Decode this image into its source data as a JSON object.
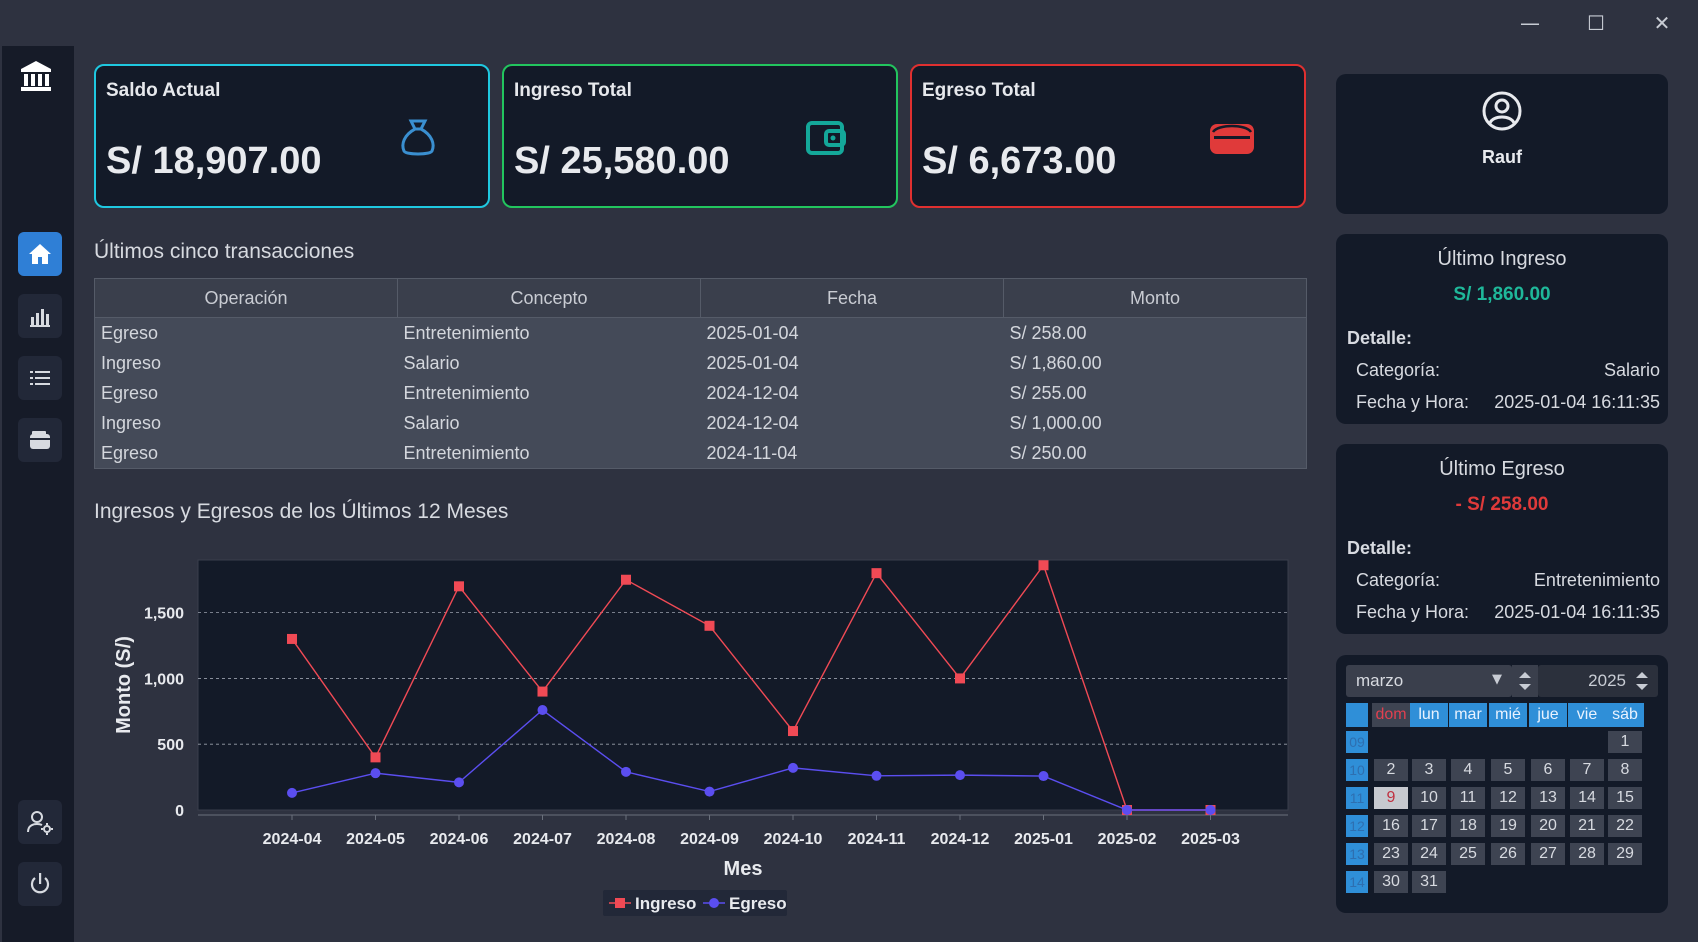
{
  "window": {
    "minimize": "—",
    "maximize": "☐",
    "close": "✕"
  },
  "cards": {
    "saldo": {
      "title": "Saldo Actual",
      "value": "S/ 18,907.00",
      "color": "#1fc8e0"
    },
    "ingreso": {
      "title": "Ingreso Total",
      "value": "S/ 25,580.00",
      "color": "#22c55e"
    },
    "egreso": {
      "title": "Egreso Total",
      "value": "S/ 6,673.00",
      "color": "#e03030"
    }
  },
  "transactions": {
    "title": "Últimos cinco transacciones",
    "columns": [
      "Operación",
      "Concepto",
      "Fecha",
      "Monto"
    ],
    "rows": [
      [
        "Egreso",
        "Entretenimiento",
        "2025-01-04",
        "S/ 258.00"
      ],
      [
        "Ingreso",
        "Salario",
        "2025-01-04",
        "S/ 1,860.00"
      ],
      [
        "Egreso",
        "Entretenimiento",
        "2024-12-04",
        "S/ 255.00"
      ],
      [
        "Ingreso",
        "Salario",
        "2024-12-04",
        "S/ 1,000.00"
      ],
      [
        "Egreso",
        "Entretenimiento",
        "2024-11-04",
        "S/ 250.00"
      ]
    ]
  },
  "chart_title": "Ingresos y Egresos de los Últimos 12 Meses",
  "chart_data": {
    "type": "line",
    "xlabel": "Mes",
    "ylabel": "Monto (S/)",
    "categories": [
      "2024-04",
      "2024-05",
      "2024-06",
      "2024-07",
      "2024-08",
      "2024-09",
      "2024-10",
      "2024-11",
      "2024-12",
      "2025-01",
      "2025-02",
      "2025-03"
    ],
    "ylim": [
      0,
      1900
    ],
    "yticks": [
      0,
      500,
      1000,
      1500
    ],
    "ytick_labels": [
      "0",
      "500",
      "1,000",
      "1,500"
    ],
    "grid": true,
    "legend": "bottom-center",
    "series": [
      {
        "name": "Ingreso",
        "color": "#f04a55",
        "marker": "square",
        "values": [
          1300,
          400,
          1700,
          900,
          1750,
          1400,
          600,
          1800,
          1000,
          1860,
          0,
          0
        ]
      },
      {
        "name": "Egreso",
        "color": "#5b4ef0",
        "marker": "circle",
        "values": [
          130,
          280,
          210,
          760,
          290,
          140,
          320,
          260,
          265,
          258,
          0,
          0
        ]
      }
    ]
  },
  "user": {
    "name": "Rauf"
  },
  "last_income": {
    "title": "Último Ingreso",
    "amount": "S/ 1,860.00",
    "detail_label": "Detalle:",
    "cat_label": "Categoría:",
    "cat_value": "Salario",
    "date_label": "Fecha y Hora:",
    "date_value": "2025-01-04 16:11:35"
  },
  "last_expense": {
    "title": "Último Egreso",
    "amount": "- S/ 258.00",
    "detail_label": "Detalle:",
    "cat_label": "Categoría:",
    "cat_value": "Entretenimiento",
    "date_label": "Fecha y Hora:",
    "date_value": "2025-01-04 16:11:35"
  },
  "calendar": {
    "month": "marzo",
    "year": "2025",
    "weekdays": [
      "dom",
      "lun",
      "mar",
      "mié",
      "jue",
      "vie",
      "sáb"
    ],
    "weeks": [
      "09",
      "10",
      "11",
      "12",
      "13",
      "14"
    ],
    "selected_day": "9",
    "days": [
      [
        "",
        "",
        "",
        "",
        "",
        "",
        "1"
      ],
      [
        "2",
        "3",
        "4",
        "5",
        "6",
        "7",
        "8"
      ],
      [
        "9",
        "10",
        "11",
        "12",
        "13",
        "14",
        "15"
      ],
      [
        "16",
        "17",
        "18",
        "19",
        "20",
        "21",
        "22"
      ],
      [
        "23",
        "24",
        "25",
        "26",
        "27",
        "28",
        "29"
      ],
      [
        "30",
        "31",
        "",
        "",
        "",
        "",
        ""
      ]
    ]
  }
}
